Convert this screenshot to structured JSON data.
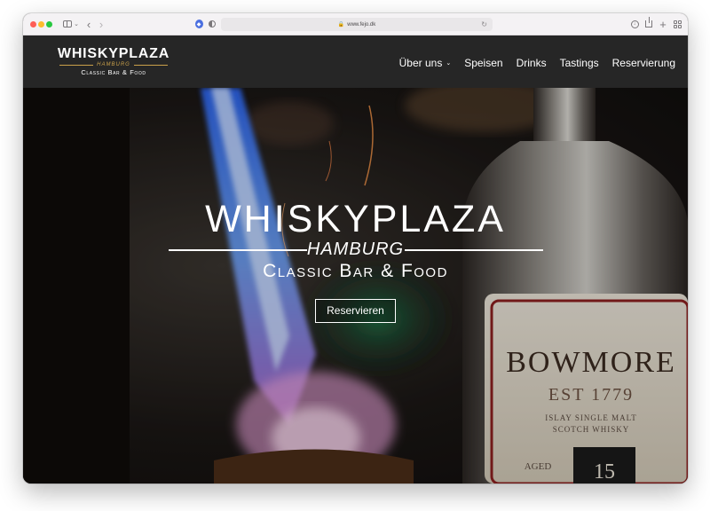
{
  "browser": {
    "url": "www.fejo.dk"
  },
  "site": {
    "logo": {
      "name": "WHISKYPLAZA",
      "city": "HAMBURG",
      "tagline": "Classic Bar & Food"
    },
    "nav": [
      {
        "label": "Über uns",
        "has_dropdown": true
      },
      {
        "label": "Speisen"
      },
      {
        "label": "Drinks"
      },
      {
        "label": "Tastings"
      },
      {
        "label": "Reservierung"
      }
    ]
  },
  "hero": {
    "title": "WHISKYPLAZA",
    "city": "HAMBURG",
    "tagline": "Classic Bar & Food",
    "cta_label": "Reservieren",
    "bottle_label": {
      "brand": "BOWMORE",
      "est": "EST 1779",
      "sub1": "ISLAY SINGLE MALT",
      "sub2": "SCOTCH WHISKY",
      "aged": "AGED",
      "years": "15"
    }
  },
  "colors": {
    "header_bg": "#262626",
    "logo_accent": "#c9a04a",
    "flame_blue": "#3f7cff",
    "flame_pink": "#e79ad6"
  }
}
